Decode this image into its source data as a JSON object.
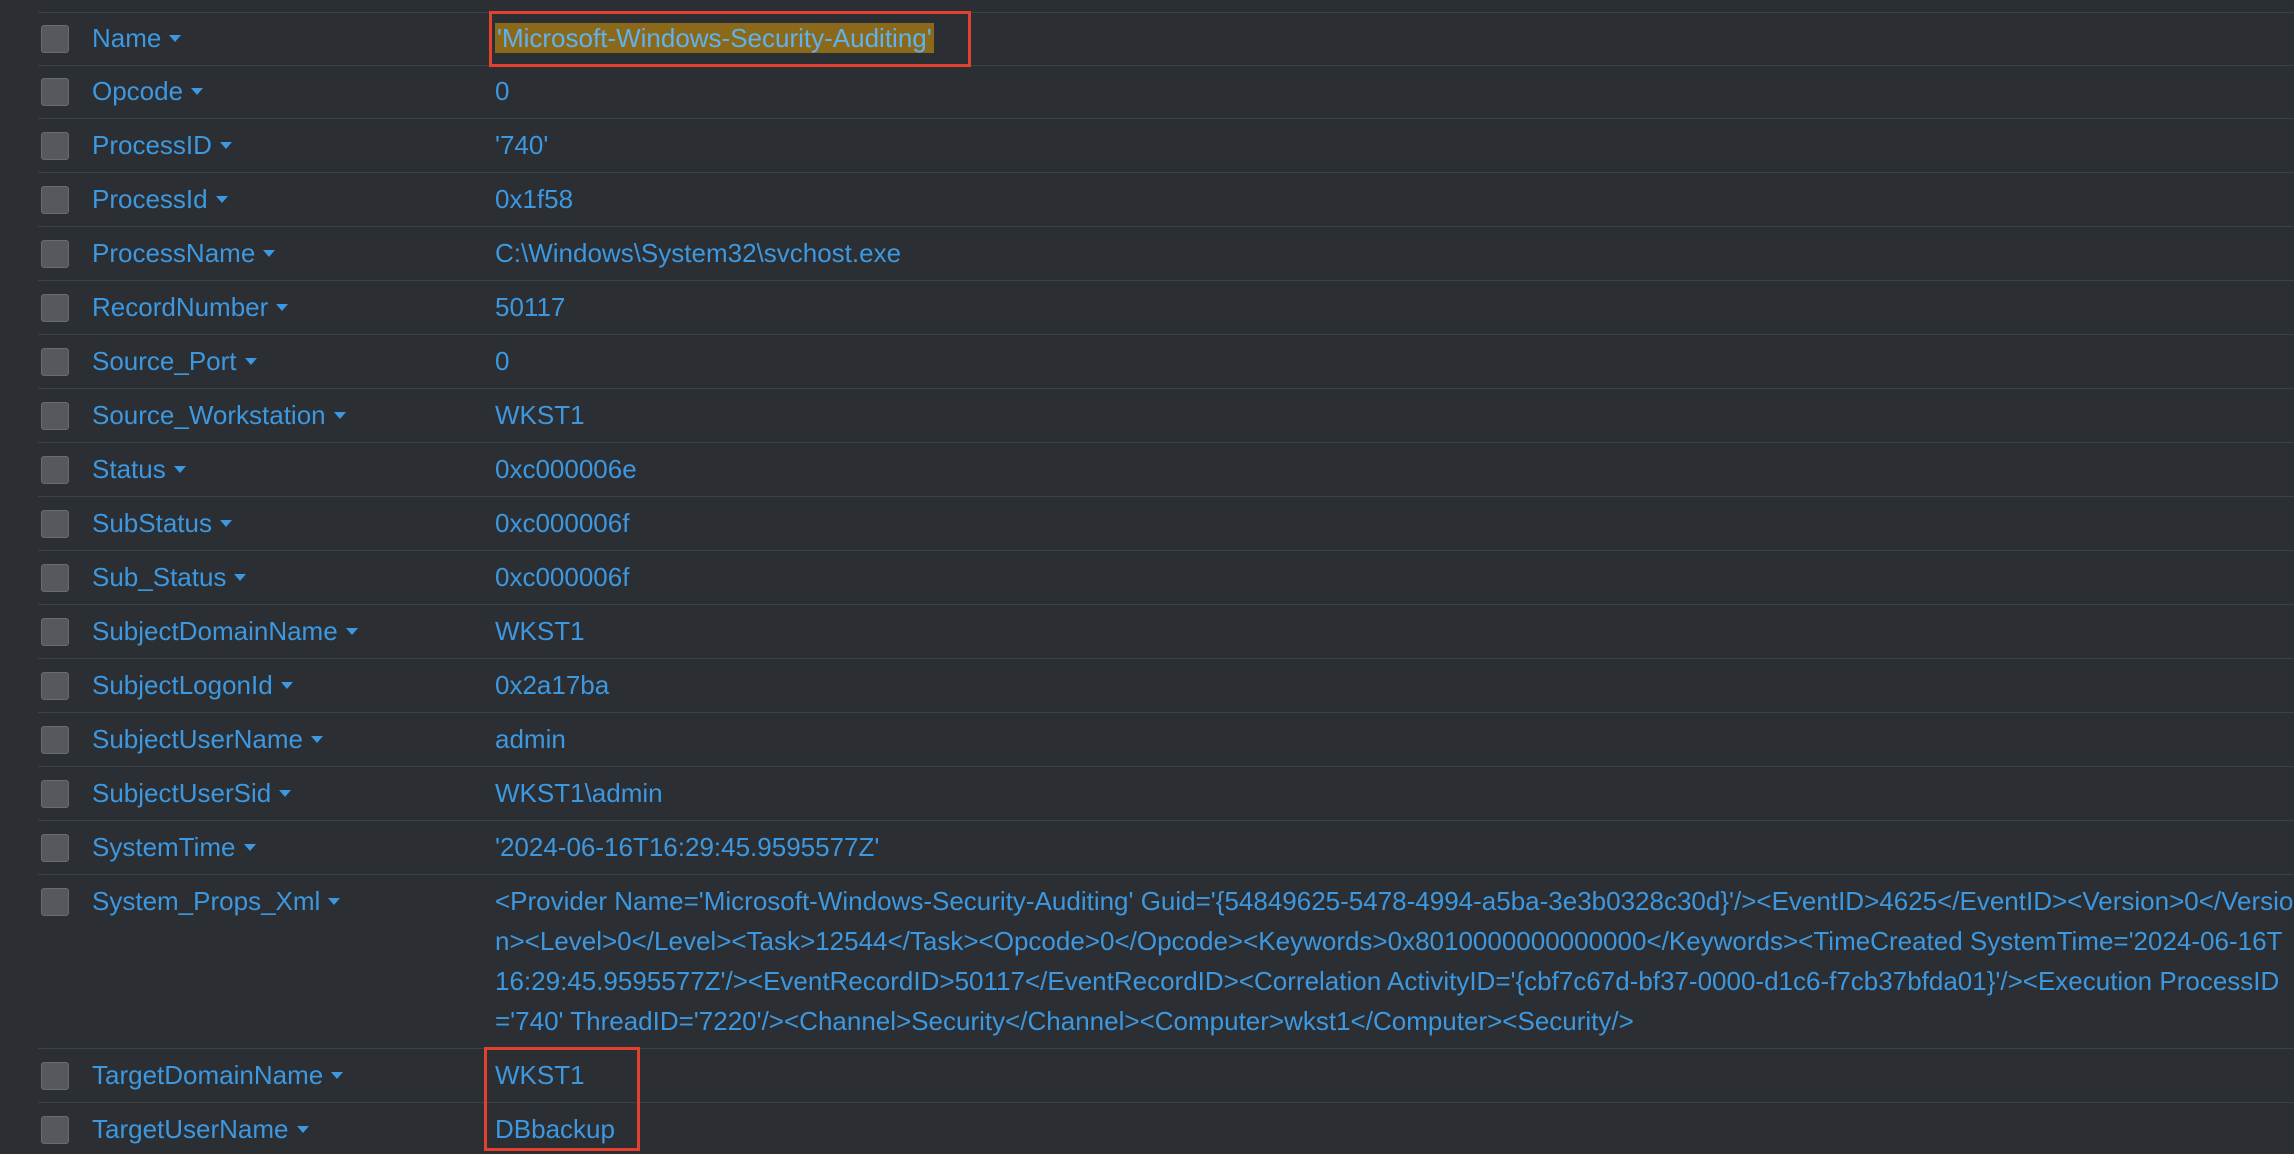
{
  "fields": [
    {
      "name": "Name",
      "value": "'Microsoft-Windows-Security-Auditing'",
      "highlighted": true
    },
    {
      "name": "Opcode",
      "value": "0"
    },
    {
      "name": "ProcessID",
      "value": "'740'"
    },
    {
      "name": "ProcessId",
      "value": "0x1f58"
    },
    {
      "name": "ProcessName",
      "value": "C:\\Windows\\System32\\svchost.exe"
    },
    {
      "name": "RecordNumber",
      "value": "50117"
    },
    {
      "name": "Source_Port",
      "value": "0"
    },
    {
      "name": "Source_Workstation",
      "value": "WKST1"
    },
    {
      "name": "Status",
      "value": "0xc000006e"
    },
    {
      "name": "SubStatus",
      "value": "0xc000006f"
    },
    {
      "name": "Sub_Status",
      "value": "0xc000006f"
    },
    {
      "name": "SubjectDomainName",
      "value": "WKST1"
    },
    {
      "name": "SubjectLogonId",
      "value": "0x2a17ba"
    },
    {
      "name": "SubjectUserName",
      "value": "admin"
    },
    {
      "name": "SubjectUserSid",
      "value": "WKST1\\admin"
    },
    {
      "name": "SystemTime",
      "value": "'2024-06-16T16:29:45.9595577Z'"
    },
    {
      "name": "System_Props_Xml",
      "value": "<Provider Name='Microsoft-Windows-Security-Auditing' Guid='{54849625-5478-4994-a5ba-3e3b0328c30d}'/><EventID>4625</EventID><Version>0</Version><Level>0</Level><Task>12544</Task><Opcode>0</Opcode><Keywords>0x8010000000000000</Keywords><TimeCreated SystemTime='2024-06-16T16:29:45.9595577Z'/><EventRecordID>50117</EventRecordID><Correlation ActivityID='{cbf7c67d-bf37-0000-d1c6-f7cb37bfda01}'/><Execution ProcessID='740' ThreadID='7220'/><Channel>Security</Channel><Computer>wkst1</Computer><Security/>"
    },
    {
      "name": "TargetDomainName",
      "value": "WKST1"
    },
    {
      "name": "TargetUserName",
      "value": "DBbackup"
    }
  ],
  "colors": {
    "background": "#2b2e32",
    "link": "#3d98e0",
    "highlight_bg": "#8a6a1a",
    "annotation_red": "#e2412d",
    "row_divider": "#3c4147"
  },
  "icons": {
    "checkbox": "square-checkbox-icon",
    "caret": "caret-down-icon"
  }
}
